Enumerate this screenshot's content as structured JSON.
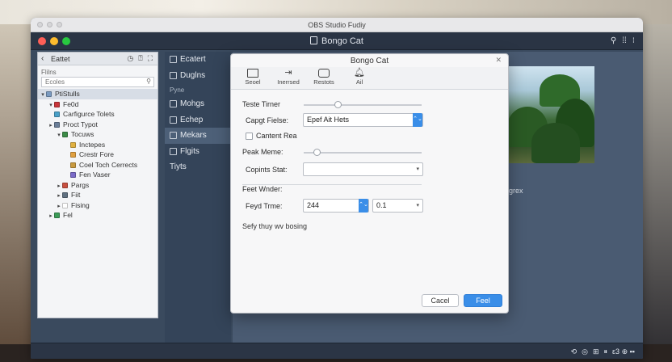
{
  "window": {
    "title": "OBS Studio Fudiy",
    "dot_colors": [
      "#ff5f57",
      "#febc2e",
      "#28c840"
    ]
  },
  "toolbar": {
    "doc_title": "Bongo Cat",
    "right_icons": [
      "⚲",
      "⁞⁞",
      "⁝"
    ]
  },
  "left_panel": {
    "header_label": "Eattet",
    "header_icons": [
      "◷",
      "⍰",
      "⛶"
    ],
    "filter_label": "Flilns",
    "search_placeholder": "Ecoles",
    "tree": [
      {
        "label": "PtiStulls",
        "indent": 0,
        "arrow": "▾",
        "icon_color": "#7a9ac0",
        "selected": true
      },
      {
        "label": "Fe0d",
        "indent": 1,
        "arrow": "▾",
        "icon_color": "#c8353a",
        "selected": false
      },
      {
        "label": "Carfigurce Tolets",
        "indent": 1,
        "arrow": "",
        "icon_color": "#4aa0c8",
        "selected": false
      },
      {
        "label": "Proct Typot",
        "indent": 1,
        "arrow": "▸",
        "icon_color": "#6a7e98",
        "selected": false
      },
      {
        "label": "Tocuws",
        "indent": 2,
        "arrow": "▾",
        "icon_color": "#3c8c48",
        "selected": false
      },
      {
        "label": "Inctepes",
        "indent": 3,
        "arrow": "",
        "icon_color": "#e0b040",
        "selected": false
      },
      {
        "label": "Crestr Fore",
        "indent": 3,
        "arrow": "",
        "icon_color": "#e0a040",
        "selected": false
      },
      {
        "label": "Coel Toch Cerrects",
        "indent": 3,
        "arrow": "",
        "icon_color": "#c89a40",
        "selected": false
      },
      {
        "label": "Fen Vaser",
        "indent": 3,
        "arrow": "",
        "icon_color": "#7a6ac8",
        "selected": false
      },
      {
        "label": "Pargs",
        "indent": 2,
        "arrow": "▸",
        "icon_color": "#c85040",
        "selected": false
      },
      {
        "label": "Fiit",
        "indent": 2,
        "arrow": "▸",
        "icon_color": "#607080",
        "selected": false
      },
      {
        "label": "Fising",
        "indent": 2,
        "arrow": "▸",
        "icon_color": "#ffffff",
        "selected": false
      },
      {
        "label": "Fel",
        "indent": 1,
        "arrow": "▸",
        "icon_color": "#3c9c58",
        "selected": false
      }
    ]
  },
  "middle_panel": {
    "items_top": [
      {
        "label": "Ecatert",
        "selected": false
      },
      {
        "label": "Duglns",
        "selected": false
      }
    ],
    "section_label": "Pyne",
    "items_bottom": [
      {
        "label": "Mohgs",
        "selected": false
      },
      {
        "label": "Echep",
        "selected": false
      },
      {
        "label": "Mekars",
        "selected": true
      },
      {
        "label": "Flgits",
        "selected": false
      },
      {
        "label": "Tiyts",
        "selected": false,
        "no_icon": true
      }
    ]
  },
  "preview": {
    "label": "grex"
  },
  "statusbar": {
    "icons": [
      "⟲",
      "◎",
      "⊞",
      "⏸"
    ],
    "text": "ε3 ⊕ ▪▪"
  },
  "dialog": {
    "title": "Bongo Cat",
    "tabs": [
      {
        "label": "Seoel",
        "icon": "box"
      },
      {
        "label": "Inerrsed",
        "icon": "arrow"
      },
      {
        "label": "Restots",
        "icon": "cam"
      },
      {
        "label": "Ail",
        "icon": "bell"
      }
    ],
    "fields": {
      "taste_timer": {
        "label": "Teste Tirner",
        "value": 0.28
      },
      "capt_fielse": {
        "label": "Capgt Fielse:",
        "value": "Epef Ait Hets"
      },
      "content_rea": {
        "label": "Cantent Rea",
        "checked": false
      },
      "peak_meme": {
        "label": "Peak Meme:",
        "value": 0.09
      },
      "copints_stat": {
        "label": "Copints Stat:",
        "value": ""
      },
      "feet_wnder": {
        "label": "Feet Wnder:"
      },
      "feyd_trme": {
        "label": "Feyd Trme:",
        "value": "244",
        "unit_value": "0.1"
      },
      "hint": "Sefy thuy wv bosing"
    },
    "cancel_label": "Cacel",
    "ok_label": "Feel"
  }
}
